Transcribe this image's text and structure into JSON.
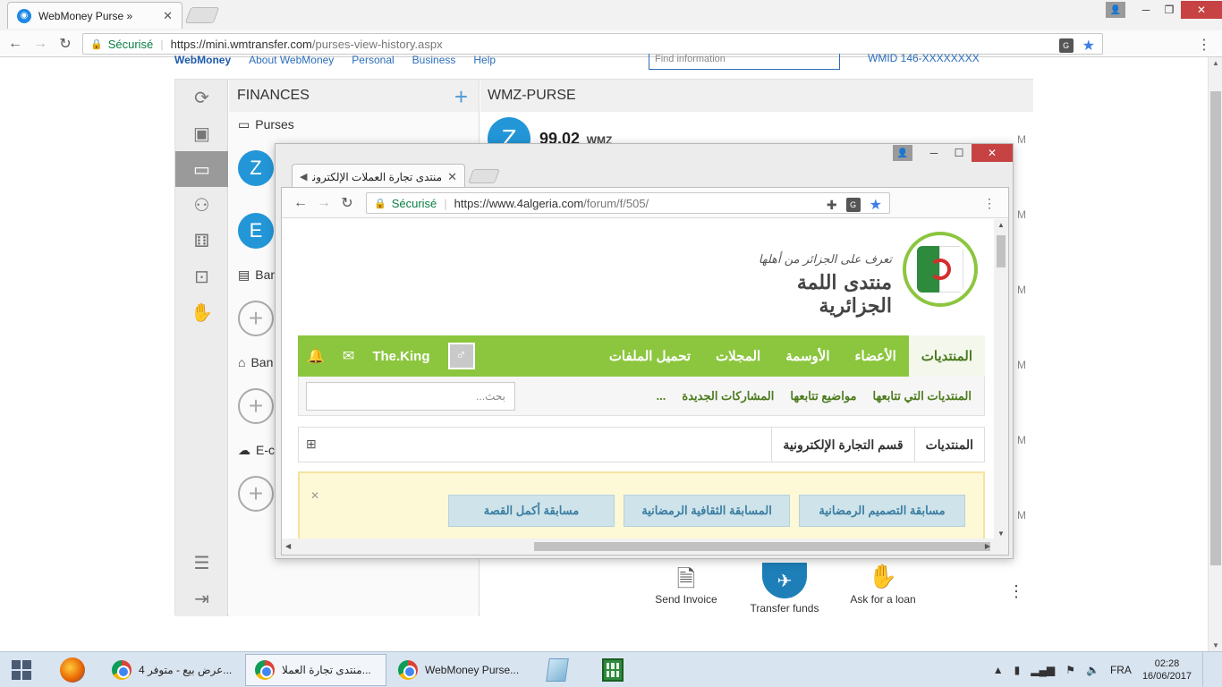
{
  "browser": {
    "tab_title": "WebMoney Purse »",
    "secure_label": "Sécurisé",
    "url_host": "https://mini.wmtransfer.com",
    "url_path": "/purses-view-history.aspx"
  },
  "wm": {
    "topnav": [
      "WebMoney",
      "About WebMoney",
      "Personal",
      "Business",
      "Help"
    ],
    "search_placeholder": "Find information",
    "wmid": "WMID 146-XXXXXXXX",
    "finances_title": "FINANCES",
    "purses_label": "Purses",
    "purse_z_letter": "Z",
    "purse_e_letter": "E",
    "bank_cards_label": "Ban",
    "bank_accounts_label": "Ban",
    "ecurrency_label": "E-c",
    "purse_title": "WMZ-PURSE",
    "balance_amount": "99.02",
    "balance_currency": "WMZ",
    "time_marks": [
      "M",
      "M",
      "M",
      "M",
      "M",
      "M"
    ],
    "actions": {
      "send_invoice": "Send Invoice",
      "transfer_funds": "Transfer funds",
      "ask_loan": "Ask for a loan"
    }
  },
  "popup": {
    "tab_title": "منتدى تجارة العملات الإلكترونية",
    "secure_label": "Sécurisé",
    "url_host": "https://www.4algeria.com",
    "url_path": "/forum/f/505/",
    "logo_subtitle": "تعرف على الجزائر من أهلها",
    "logo_title": "منتدى اللمة الجزائرية",
    "nav": [
      "المنتديات",
      "الأعضاء",
      "الأوسمة",
      "المجلات",
      "تحميل الملفات"
    ],
    "username": "The.King",
    "subnav": [
      "المنتديات التي تتابعها",
      "مواضيع تتابعها",
      "المشاركات الجديدة",
      "..."
    ],
    "search_placeholder": "بحث...",
    "breadcrumb": [
      "المنتديات",
      "قسم التجارة الإلكترونية"
    ],
    "notice_buttons": [
      "مسابقة التصميم الرمضانية",
      "المسابقة الثقافية الرمضانية",
      "مسابقة أكمل القصة"
    ]
  },
  "taskbar": {
    "tasks": [
      {
        "label": "عرض بيع - متوفر 4..."
      },
      {
        "label": "منتدى تجارة العملا..."
      },
      {
        "label": "WebMoney Purse..."
      }
    ],
    "lang": "FRA",
    "time": "02:28",
    "date": "16/06/2017"
  },
  "colors": {
    "wm_blue": "#2396d8",
    "forum_green": "#8cc63f",
    "close_red": "#c74242"
  }
}
